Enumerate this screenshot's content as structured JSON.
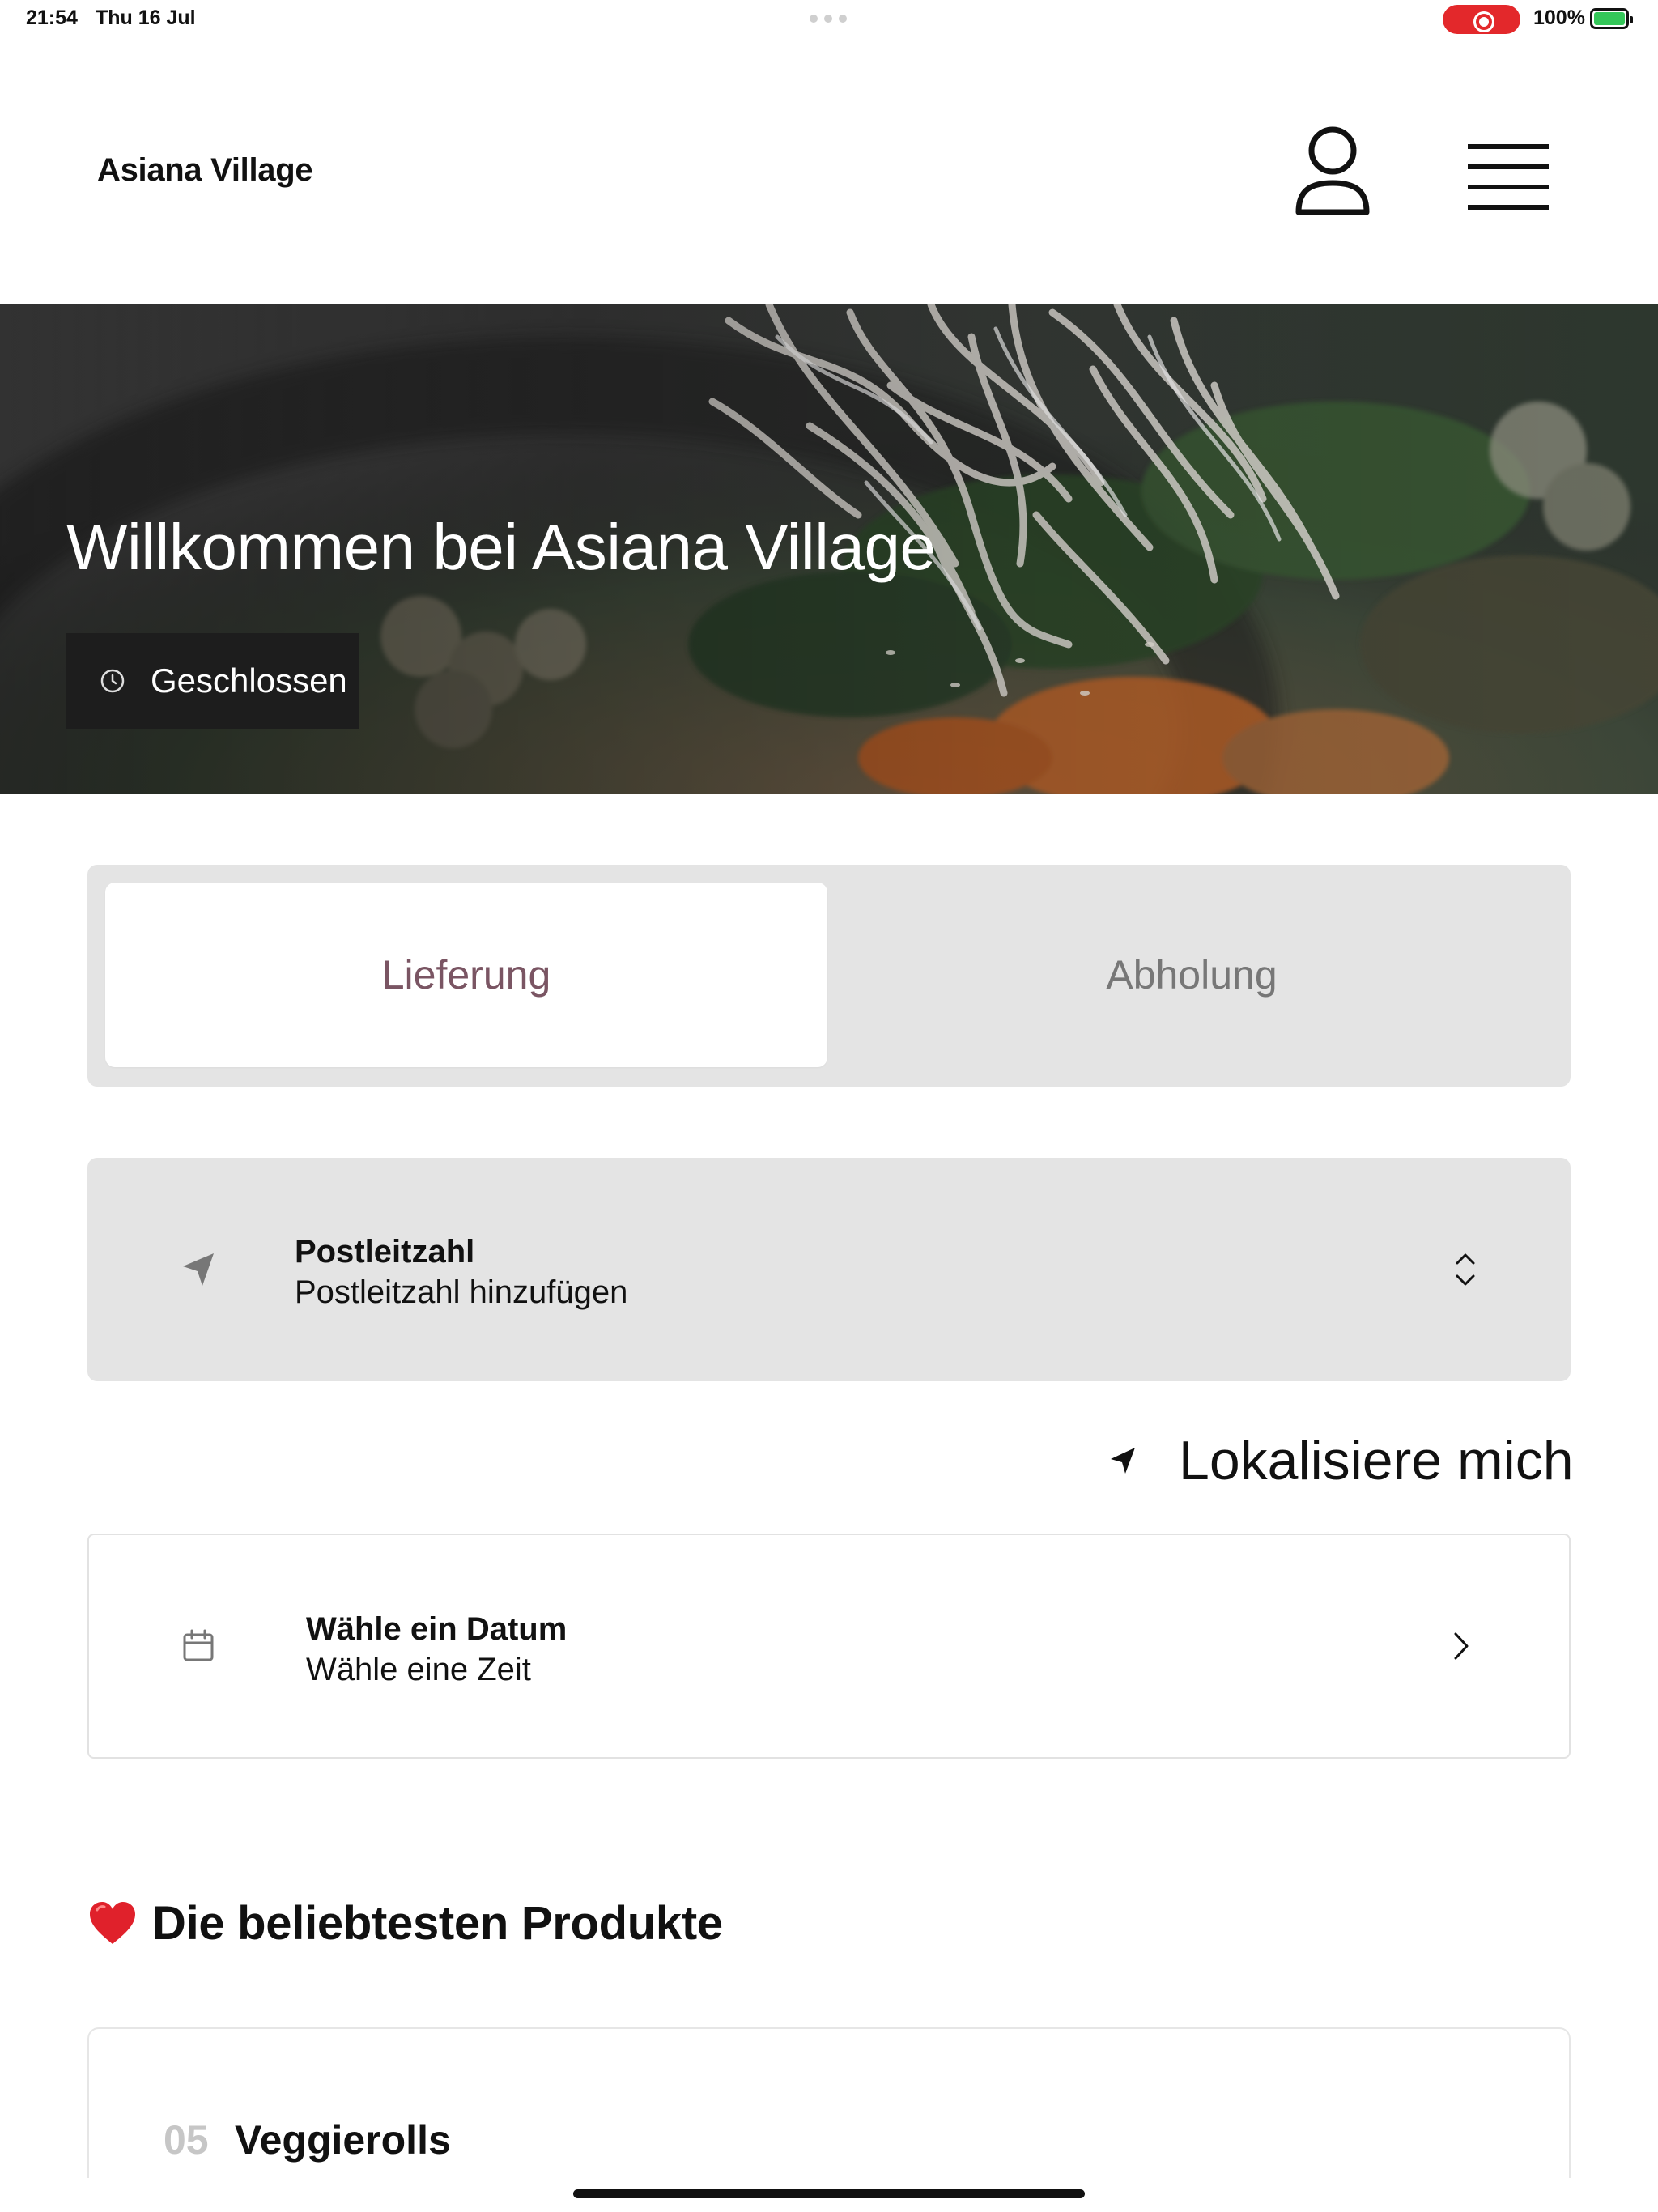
{
  "status_bar": {
    "time": "21:54",
    "date": "Thu 16 Jul",
    "battery": "100%",
    "recording_color": "#e3282b",
    "battery_color": "#34c759"
  },
  "header": {
    "brand": "Asiana Village",
    "user_icon": "user-icon",
    "menu_icon": "hamburger-menu-icon"
  },
  "hero": {
    "title": "Willkommen bei Asiana Village",
    "status": "Geschlossen",
    "status_icon": "clock-icon"
  },
  "order_mode": {
    "tabs": [
      {
        "label": "Lieferung",
        "active": true
      },
      {
        "label": "Abholung",
        "active": false
      }
    ],
    "active_color": "#7a5563"
  },
  "postcode": {
    "label": "Postleitzahl",
    "value": "Postleitzahl hinzufügen",
    "icon": "location-arrow-icon",
    "chevron_icon": "chevron-up-down-icon"
  },
  "locate": {
    "label": "Lokalisiere mich",
    "icon": "navigation-arrow-icon"
  },
  "schedule": {
    "label": "Wähle ein Datum",
    "value": "Wähle eine Zeit",
    "icon": "calendar-icon",
    "chevron_icon": "chevron-right-icon"
  },
  "popular": {
    "title": "Die beliebtesten Produkte",
    "icon": "heart-icon",
    "products": [
      {
        "number": "05",
        "name": "Veggierolls"
      }
    ]
  }
}
